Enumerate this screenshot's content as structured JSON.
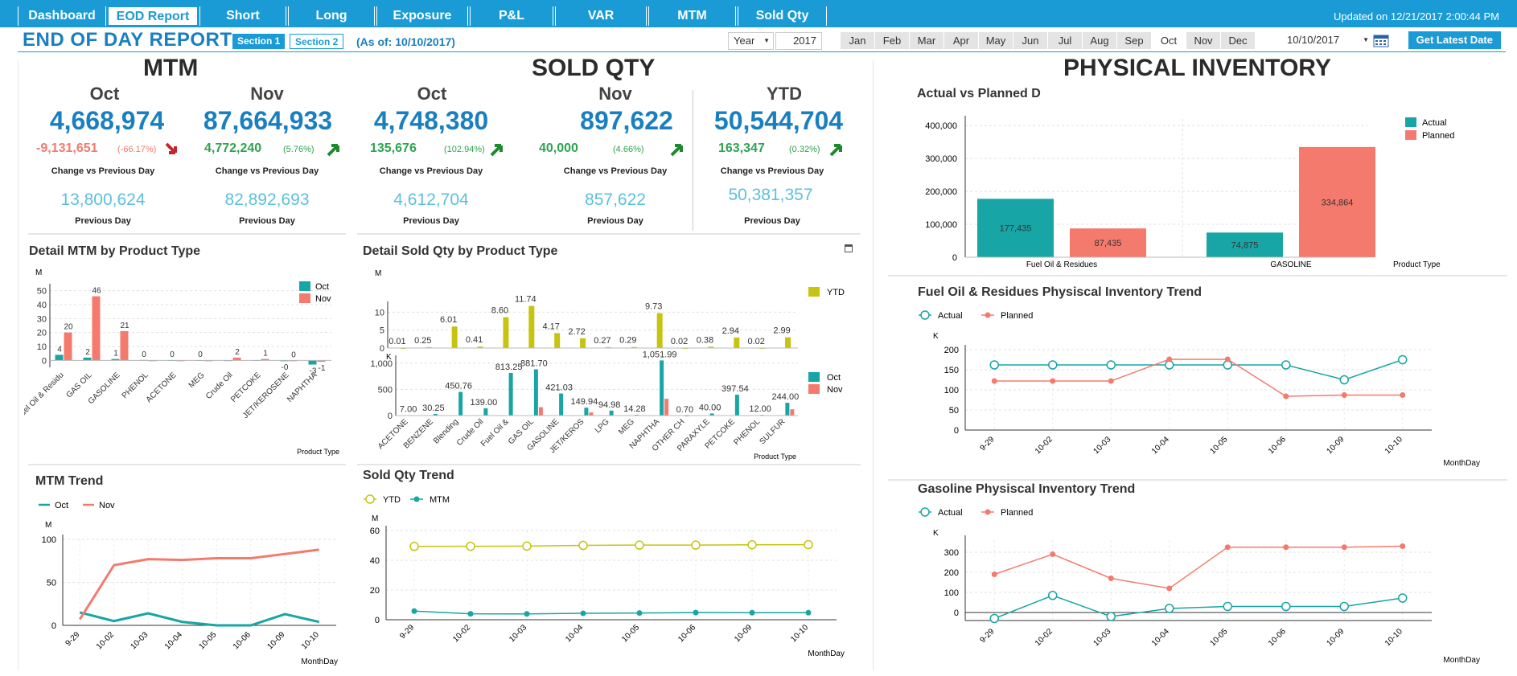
{
  "nav": {
    "tabs": [
      "Dashboard",
      "EOD Report",
      "Short",
      "Long",
      "Exposure",
      "P&L",
      "VAR",
      "MTM",
      "Sold Qty"
    ],
    "active": "EOD Report",
    "updated": "Updated on 12/21/2017 2:00:44 PM"
  },
  "header": {
    "title": "END OF DAY REPORT",
    "section1": "Section 1",
    "section2": "Section 2",
    "as_of": "(As of: 10/10/2017)",
    "period_label": "Year",
    "year": "2017",
    "months": [
      "Jan",
      "Feb",
      "Mar",
      "Apr",
      "May",
      "Jun",
      "Jul",
      "Aug",
      "Sep",
      "Oct",
      "Nov",
      "Dec"
    ],
    "selected_month": "Oct",
    "date": "10/10/2017",
    "get_latest": "Get Latest Date"
  },
  "colors": {
    "teal": "#17a5a5",
    "salmon": "#f47a6e",
    "olive": "#c6c410",
    "blue": "#1a7fc0",
    "lightblue": "#5bc0de",
    "nav": "#1a9bd6"
  },
  "mtm": {
    "heading": "MTM",
    "oct": {
      "label": "Oct",
      "value": "4,668,974",
      "change": "-9,131,651",
      "pct": "(-66.17%)",
      "caption": "Change vs Previous Day",
      "prev": "13,800,624",
      "prev_caption": "Previous Day"
    },
    "nov": {
      "label": "Nov",
      "value": "87,664,933",
      "change": "4,772,240",
      "pct": "(5.76%)",
      "caption": "Change vs Previous Day",
      "prev": "82,892,693",
      "prev_caption": "Previous Day"
    }
  },
  "sold": {
    "heading": "SOLD QTY",
    "oct": {
      "label": "Oct",
      "value": "4,748,380",
      "change": "135,676",
      "pct": "(102.94%)",
      "caption": "Change vs Previous Day",
      "prev": "4,612,704",
      "prev_caption": "Previous Day"
    },
    "nov": {
      "label": "Nov",
      "value": "897,622",
      "change": "40,000",
      "pct": "(4.66%)",
      "caption": "Change vs Previous Day",
      "prev": "857,622",
      "prev_caption": "Previous Day"
    },
    "ytd": {
      "label": "YTD",
      "value": "50,544,704",
      "change": "163,347",
      "pct": "(0.32%)",
      "caption": "Change vs Previous Day",
      "prev": "50,381,357",
      "prev_caption": "Previous Day"
    }
  },
  "physical": {
    "heading": "PHYSICAL INVENTORY"
  },
  "chart_data": [
    {
      "id": "mtm_detail",
      "type": "bar",
      "title": "Detail MTM by Product Type",
      "ylabel": "M",
      "xlabel": "Product Type",
      "ylim": [
        -5,
        55
      ],
      "yticks": [
        0,
        10,
        20,
        30,
        40,
        50
      ],
      "categories": [
        "Fuel Oil & Residu",
        "GAS OIL",
        "GASOLINE",
        "PHENOL",
        "ACETONE",
        "MEG",
        "Crude Oil",
        "PETCOKE",
        "JET/KEROSENE",
        "NAPHTHA"
      ],
      "series": [
        {
          "name": "Oct",
          "values": [
            4,
            2,
            1,
            0.3,
            0.2,
            0.2,
            0.1,
            0.2,
            -0.3,
            -3
          ],
          "labels": [
            "4",
            "2",
            "1",
            "0",
            "0",
            "0",
            "",
            "",
            "-0",
            "-3"
          ]
        },
        {
          "name": "Nov",
          "values": [
            20,
            46,
            21,
            0,
            0,
            0,
            2,
            1,
            0,
            -1
          ],
          "labels": [
            "20",
            "46",
            "21",
            "",
            "",
            "",
            "2",
            "1",
            "0",
            "-1"
          ]
        }
      ]
    },
    {
      "id": "sold_ytd",
      "type": "bar",
      "title": "Detail Sold Qty by Product Type",
      "ylabel": "M",
      "ylim": [
        0,
        13
      ],
      "yticks": [
        0,
        5,
        10
      ],
      "categories": [
        "ACETONE",
        "BENZENE",
        "Blending",
        "Crude Oil",
        "Fuel Oil &",
        "GAS OIL",
        "GASOLINE",
        "JET/KEROS",
        "LPG",
        "MEG",
        "NAPHTHA",
        "OTHER CH",
        "PARAXYLE",
        "PETCOKE",
        "PHENOL",
        "SULFUR"
      ],
      "series": [
        {
          "name": "YTD",
          "values": [
            0.01,
            0.25,
            6.01,
            0.41,
            8.6,
            11.74,
            4.17,
            2.72,
            0.27,
            0.29,
            9.73,
            0.02,
            0.38,
            2.94,
            0.02,
            2.99
          ],
          "labels": [
            "0.01",
            "0.25",
            "6.01",
            "0.41",
            "8.60",
            "11.74",
            "4.17",
            "2.72",
            "0.27",
            "0.29",
            "9.73",
            "0.02",
            "0.38",
            "2.94",
            "0.02",
            "2.99"
          ]
        }
      ]
    },
    {
      "id": "sold_month",
      "type": "bar",
      "ylabel": "K",
      "xlabel": "Product Type",
      "ylim": [
        0,
        1150
      ],
      "yticks": [
        0,
        500,
        1000
      ],
      "ytick_labels": [
        "0",
        "500",
        "1,000"
      ],
      "categories": [
        "ACETONE",
        "BENZENE",
        "Blending",
        "Crude Oil",
        "Fuel Oil &",
        "GAS OIL",
        "GASOLINE",
        "JET/KEROS",
        "LPG",
        "MEG",
        "NAPHTHA",
        "OTHER CH",
        "PARAXYLE",
        "PETCOKE",
        "PHENOL",
        "SULFUR"
      ],
      "series": [
        {
          "name": "Oct",
          "values": [
            7,
            30.25,
            450.76,
            139,
            813.25,
            881.7,
            421.03,
            149.94,
            94.98,
            14.28,
            1051.99,
            0.7,
            40,
            397.54,
            12,
            244
          ],
          "labels": [
            "7.00",
            "30.25",
            "450.76",
            "139.00",
            "813.25",
            "881.70",
            "421.03",
            "149.94",
            "94.98",
            "14.28",
            "1,051.99",
            "0.70",
            "40.00",
            "397.54",
            "12.00",
            "244.00"
          ]
        },
        {
          "name": "Nov",
          "values": [
            0,
            0,
            0,
            0,
            0,
            160,
            0,
            60,
            0,
            0,
            320,
            0,
            0,
            0,
            0,
            120
          ],
          "labels": []
        }
      ]
    },
    {
      "id": "actual_planned",
      "type": "bar",
      "title": "Actual vs Planned D",
      "xlabel": "Product Type",
      "ylim": [
        0,
        420000
      ],
      "yticks": [
        0,
        100000,
        200000,
        300000,
        400000
      ],
      "ytick_labels": [
        "0",
        "100,000",
        "200,000",
        "300,000",
        "400,000"
      ],
      "categories": [
        "Fuel Oil & Residues",
        "GASOLINE"
      ],
      "series": [
        {
          "name": "Actual",
          "values": [
            177435,
            74875
          ],
          "labels": [
            "177,435",
            "74,875"
          ]
        },
        {
          "name": "Planned",
          "values": [
            87435,
            334864
          ],
          "labels": [
            "87,435",
            "334,864"
          ]
        }
      ]
    },
    {
      "id": "mtm_trend",
      "type": "line",
      "title": "MTM Trend",
      "ylabel": "M",
      "xlabel": "MonthDay",
      "ylim": [
        0,
        100
      ],
      "yticks": [
        0,
        50,
        100
      ],
      "x": [
        "9-29",
        "10-02",
        "10-03",
        "10-04",
        "10-05",
        "10-06",
        "10-09",
        "10-10"
      ],
      "series": [
        {
          "name": "Oct",
          "values": [
            15,
            5,
            14,
            4,
            0,
            0,
            13,
            4
          ]
        },
        {
          "name": "Nov",
          "values": [
            7,
            70,
            77,
            76,
            78,
            78,
            83,
            88
          ]
        }
      ]
    },
    {
      "id": "sold_trend",
      "type": "line",
      "title": "Sold Qty Trend",
      "ylabel": "M",
      "xlabel": "MonthDay",
      "ylim": [
        0,
        60
      ],
      "yticks": [
        0,
        20,
        40,
        60
      ],
      "x": [
        "9-29",
        "10-02",
        "10-03",
        "10-04",
        "10-05",
        "10-06",
        "10-09",
        "10-10"
      ],
      "series": [
        {
          "name": "YTD",
          "values": [
            49.3,
            49.4,
            49.5,
            50,
            50.2,
            50.2,
            50.4,
            50.5
          ]
        },
        {
          "name": "MTM",
          "values": [
            5.8,
            4,
            3.9,
            4.3,
            4.5,
            4.8,
            4.7,
            4.7
          ]
        }
      ]
    },
    {
      "id": "fuel_trend",
      "type": "line",
      "title": "Fuel Oil & Residues Physiscal Inventory Trend",
      "ylabel": "K",
      "xlabel": "MonthDay",
      "ylim": [
        0,
        200
      ],
      "yticks": [
        0,
        50,
        100,
        150,
        200
      ],
      "x": [
        "9-29",
        "10-02",
        "10-03",
        "10-04",
        "10-05",
        "10-06",
        "10-09",
        "10-10"
      ],
      "series": [
        {
          "name": "Actual",
          "values": [
            162,
            162,
            162,
            162,
            162,
            162,
            125,
            175
          ]
        },
        {
          "name": "Planned",
          "values": [
            122,
            122,
            122,
            176,
            176,
            84,
            87,
            87
          ]
        }
      ]
    },
    {
      "id": "gas_trend",
      "type": "line",
      "title": "Gasoline Physiscal Inventory Trend",
      "ylabel": "K",
      "xlabel": "MonthDay",
      "ylim": [
        -40,
        360
      ],
      "yticks": [
        0,
        100,
        200,
        300
      ],
      "x": [
        "9-29",
        "10-02",
        "10-03",
        "10-04",
        "10-05",
        "10-06",
        "10-09",
        "10-10"
      ],
      "series": [
        {
          "name": "Actual",
          "values": [
            -30,
            85,
            -20,
            20,
            30,
            30,
            30,
            72
          ]
        },
        {
          "name": "Planned",
          "values": [
            190,
            290,
            170,
            120,
            325,
            325,
            325,
            330
          ]
        }
      ]
    }
  ]
}
